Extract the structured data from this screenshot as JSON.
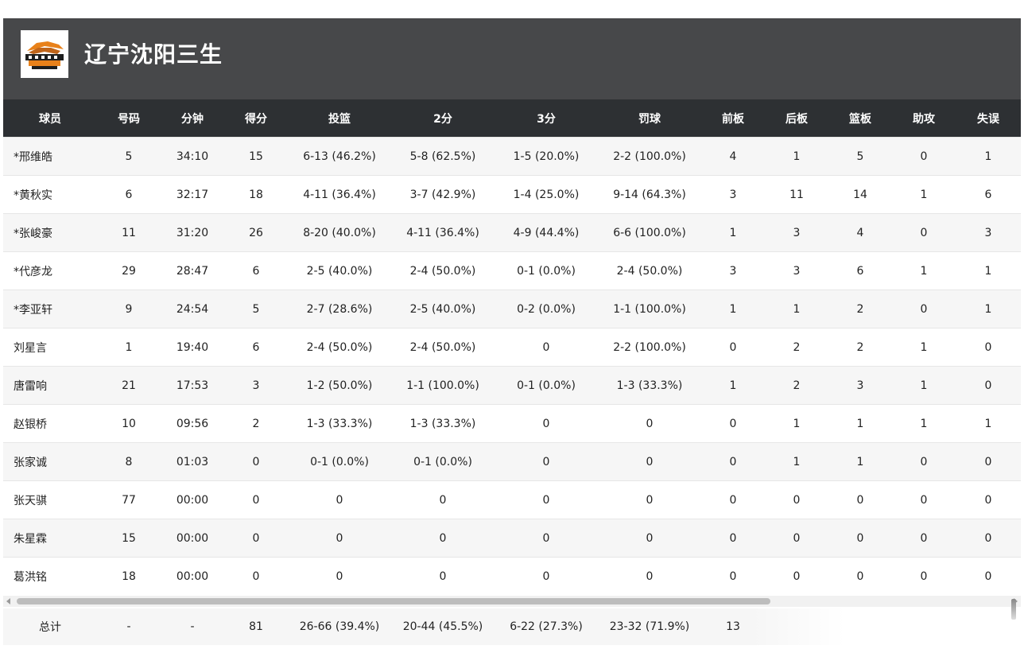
{
  "team": {
    "name": "辽宁沈阳三生",
    "logo_icon": "liaoning-flying-leopards-logo"
  },
  "columns": [
    "球员",
    "号码",
    "分钟",
    "得分",
    "投篮",
    "2分",
    "3分",
    "罚球",
    "前板",
    "后板",
    "篮板",
    "助攻",
    "失误"
  ],
  "players": [
    [
      "*邢维皓",
      "5",
      "34:10",
      "15",
      "6-13 (46.2%)",
      "5-8 (62.5%)",
      "1-5 (20.0%)",
      "2-2 (100.0%)",
      "4",
      "1",
      "5",
      "0",
      "1"
    ],
    [
      "*黄秋实",
      "6",
      "32:17",
      "18",
      "4-11 (36.4%)",
      "3-7 (42.9%)",
      "1-4 (25.0%)",
      "9-14 (64.3%)",
      "3",
      "11",
      "14",
      "1",
      "6"
    ],
    [
      "*张峻豪",
      "11",
      "31:20",
      "26",
      "8-20 (40.0%)",
      "4-11 (36.4%)",
      "4-9 (44.4%)",
      "6-6 (100.0%)",
      "1",
      "3",
      "4",
      "0",
      "3"
    ],
    [
      "*代彦龙",
      "29",
      "28:47",
      "6",
      "2-5 (40.0%)",
      "2-4 (50.0%)",
      "0-1 (0.0%)",
      "2-4 (50.0%)",
      "3",
      "3",
      "6",
      "1",
      "1"
    ],
    [
      "*李亚轩",
      "9",
      "24:54",
      "5",
      "2-7 (28.6%)",
      "2-5 (40.0%)",
      "0-2 (0.0%)",
      "1-1 (100.0%)",
      "1",
      "1",
      "2",
      "0",
      "1"
    ],
    [
      "刘星言",
      "1",
      "19:40",
      "6",
      "2-4 (50.0%)",
      "2-4 (50.0%)",
      "0",
      "2-2 (100.0%)",
      "0",
      "2",
      "2",
      "1",
      "0"
    ],
    [
      "唐雷响",
      "21",
      "17:53",
      "3",
      "1-2 (50.0%)",
      "1-1 (100.0%)",
      "0-1 (0.0%)",
      "1-3 (33.3%)",
      "1",
      "2",
      "3",
      "1",
      "0"
    ],
    [
      "赵银桥",
      "10",
      "09:56",
      "2",
      "1-3 (33.3%)",
      "1-3 (33.3%)",
      "0",
      "0",
      "0",
      "1",
      "1",
      "1",
      "1"
    ],
    [
      "张家诚",
      "8",
      "01:03",
      "0",
      "0-1 (0.0%)",
      "0-1 (0.0%)",
      "0",
      "0",
      "0",
      "1",
      "1",
      "0",
      "0"
    ],
    [
      "张天骐",
      "77",
      "00:00",
      "0",
      "0",
      "0",
      "0",
      "0",
      "0",
      "0",
      "0",
      "0",
      "0"
    ],
    [
      "朱星霖",
      "15",
      "00:00",
      "0",
      "0",
      "0",
      "0",
      "0",
      "0",
      "0",
      "0",
      "0",
      "0"
    ],
    [
      "葛洪铭",
      "18",
      "00:00",
      "0",
      "0",
      "0",
      "0",
      "0",
      "0",
      "0",
      "0",
      "0",
      "0"
    ]
  ],
  "totals": [
    "总计",
    "-",
    "-",
    "81",
    "26-66 (39.4%)",
    "20-44 (45.5%)",
    "6-22 (27.3%)",
    "23-32 (71.9%)",
    "13",
    "",
    "",
    "",
    ""
  ],
  "colors": {
    "header_bg": "#47484a",
    "table_header_bg": "#2d3033",
    "row_alt_bg": "#f6f6f6",
    "logo_accent": "#e8811a"
  }
}
